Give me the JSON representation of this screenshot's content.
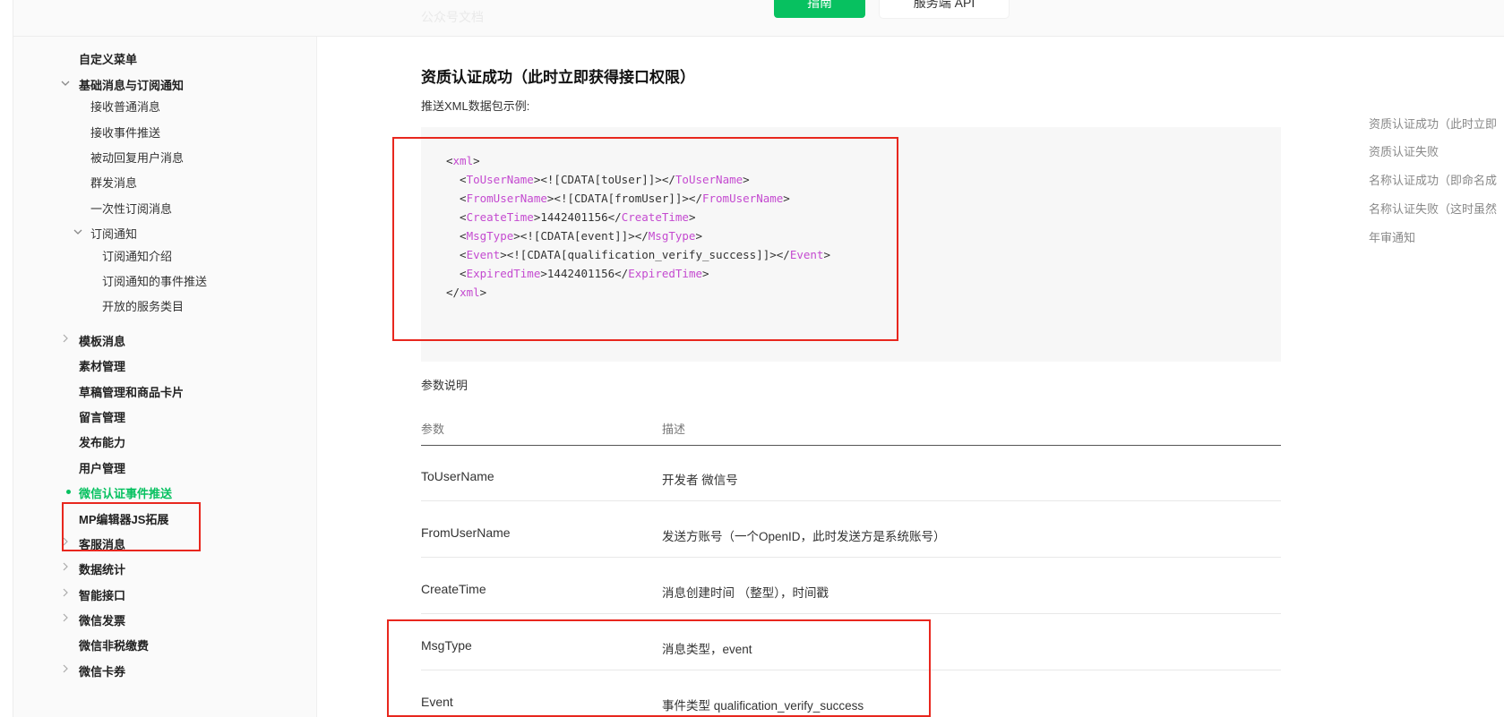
{
  "header": {
    "breadcrumb": "公众号文档",
    "guide_button": "指南",
    "api_button": "服务端 API"
  },
  "sidebar": {
    "items": [
      {
        "label": "自定义菜单",
        "style": "bold"
      },
      {
        "label": "基础消息与订阅通知",
        "style": "bold",
        "chevron": "expanded"
      },
      {
        "label": "接收普通消息",
        "style": "sub"
      },
      {
        "label": "接收事件推送",
        "style": "sub"
      },
      {
        "label": "被动回复用户消息",
        "style": "sub"
      },
      {
        "label": "群发消息",
        "style": "sub"
      },
      {
        "label": "一次性订阅消息",
        "style": "sub"
      },
      {
        "label": "订阅通知",
        "style": "sub",
        "chevron": "expanded"
      },
      {
        "label": "订阅通知介绍",
        "style": "sub2"
      },
      {
        "label": "订阅通知的事件推送",
        "style": "sub2"
      },
      {
        "label": "开放的服务类目",
        "style": "sub2"
      },
      {
        "label": "模板消息",
        "style": "bold",
        "chevron": "collapsed"
      },
      {
        "label": "素材管理",
        "style": "bold"
      },
      {
        "label": "草稿管理和商品卡片",
        "style": "bold"
      },
      {
        "label": "留言管理",
        "style": "bold"
      },
      {
        "label": "发布能力",
        "style": "bold"
      },
      {
        "label": "用户管理",
        "style": "bold"
      },
      {
        "label": "微信认证事件推送",
        "style": "active"
      },
      {
        "label": "MP编辑器JS拓展",
        "style": "bold"
      },
      {
        "label": "客服消息",
        "style": "bold",
        "chevron": "collapsed"
      },
      {
        "label": "数据统计",
        "style": "bold",
        "chevron": "collapsed"
      },
      {
        "label": "智能接口",
        "style": "bold",
        "chevron": "collapsed"
      },
      {
        "label": "微信发票",
        "style": "bold",
        "chevron": "collapsed"
      },
      {
        "label": "微信非税缴费",
        "style": "bold"
      },
      {
        "label": "微信卡券",
        "style": "bold",
        "chevron": "collapsed"
      }
    ]
  },
  "content": {
    "title": "资质认证成功（此时立即获得接口权限）",
    "subtitle": "推送XML数据包示例:",
    "code": [
      {
        "pre": "<",
        "tag": "xml",
        "mid": "",
        "tag2": "",
        "post": ">"
      },
      {
        "pre": "  <",
        "tag": "ToUserName",
        "mid": "><![CDATA[toUser]]></",
        "tag2": "ToUserName",
        "post": ">"
      },
      {
        "pre": "  <",
        "tag": "FromUserName",
        "mid": "><![CDATA[fromUser]]></",
        "tag2": "FromUserName",
        "post": ">"
      },
      {
        "pre": "  <",
        "tag": "CreateTime",
        "mid": ">1442401156</",
        "tag2": "CreateTime",
        "post": ">"
      },
      {
        "pre": "  <",
        "tag": "MsgType",
        "mid": "><![CDATA[event]]></",
        "tag2": "MsgType",
        "post": ">"
      },
      {
        "pre": "  <",
        "tag": "Event",
        "mid": "><![CDATA[qualification_verify_success]]></",
        "tag2": "Event",
        "post": ">"
      },
      {
        "pre": "  <",
        "tag": "ExpiredTime",
        "mid": ">1442401156</",
        "tag2": "ExpiredTime",
        "post": ">"
      },
      {
        "pre": "</",
        "tag": "xml",
        "mid": "",
        "tag2": "",
        "post": ">"
      }
    ],
    "params_title": "参数说明",
    "table": {
      "headers": [
        "参数",
        "描述"
      ],
      "rows": [
        {
          "param": "ToUserName",
          "desc": "开发者 微信号"
        },
        {
          "param": "FromUserName",
          "desc": "发送方账号（一个OpenID，此时发送方是系统账号）"
        },
        {
          "param": "CreateTime",
          "desc": "消息创建时间 （整型），时间戳"
        },
        {
          "param": "MsgType",
          "desc": "消息类型，event"
        },
        {
          "param": "Event",
          "desc": "事件类型 qualification_verify_success"
        }
      ]
    }
  },
  "toc": {
    "items": [
      "资质认证成功（此时立即",
      "资质认证失败",
      "名称认证成功（即命名成",
      "名称认证失败（这时虽然",
      "年审通知"
    ]
  },
  "colors": {
    "brand_green": "#07c160",
    "xml_tag": "#c44ad0",
    "highlight_red": "#e8271e"
  }
}
